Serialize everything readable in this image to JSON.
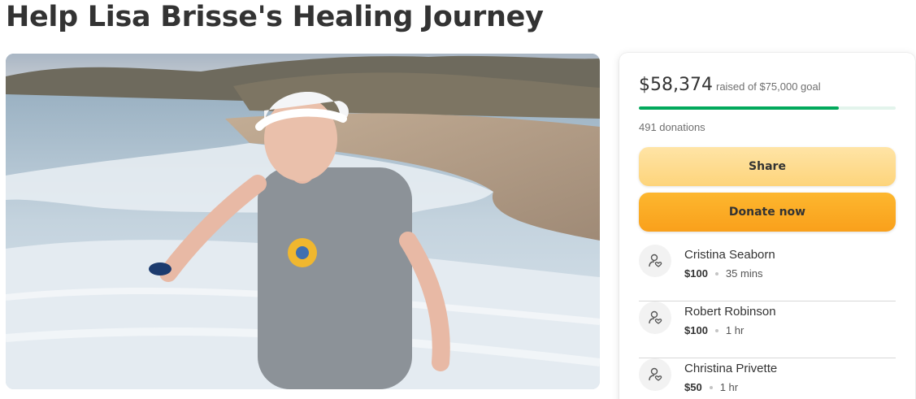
{
  "page": {
    "title": "Help Lisa Brisse's Healing Journey"
  },
  "hero": {
    "alt": "beach-photo"
  },
  "summary": {
    "raised": "$58,374",
    "goal_text": "raised of $75,000 goal",
    "progress": 0.778,
    "donations": "491 donations",
    "progress_color": "#02a95c"
  },
  "actions": {
    "share_label": "Share",
    "donate_label": "Donate now"
  },
  "donors": [
    {
      "name": "Cristina Seaborn",
      "amount": "$100",
      "time": "35 mins"
    },
    {
      "name": "Robert Robinson",
      "amount": "$100",
      "time": "1 hr"
    },
    {
      "name": "Christina Privette",
      "amount": "$50",
      "time": "1 hr"
    }
  ],
  "icons": {
    "donor": "donor-heart-icon"
  }
}
